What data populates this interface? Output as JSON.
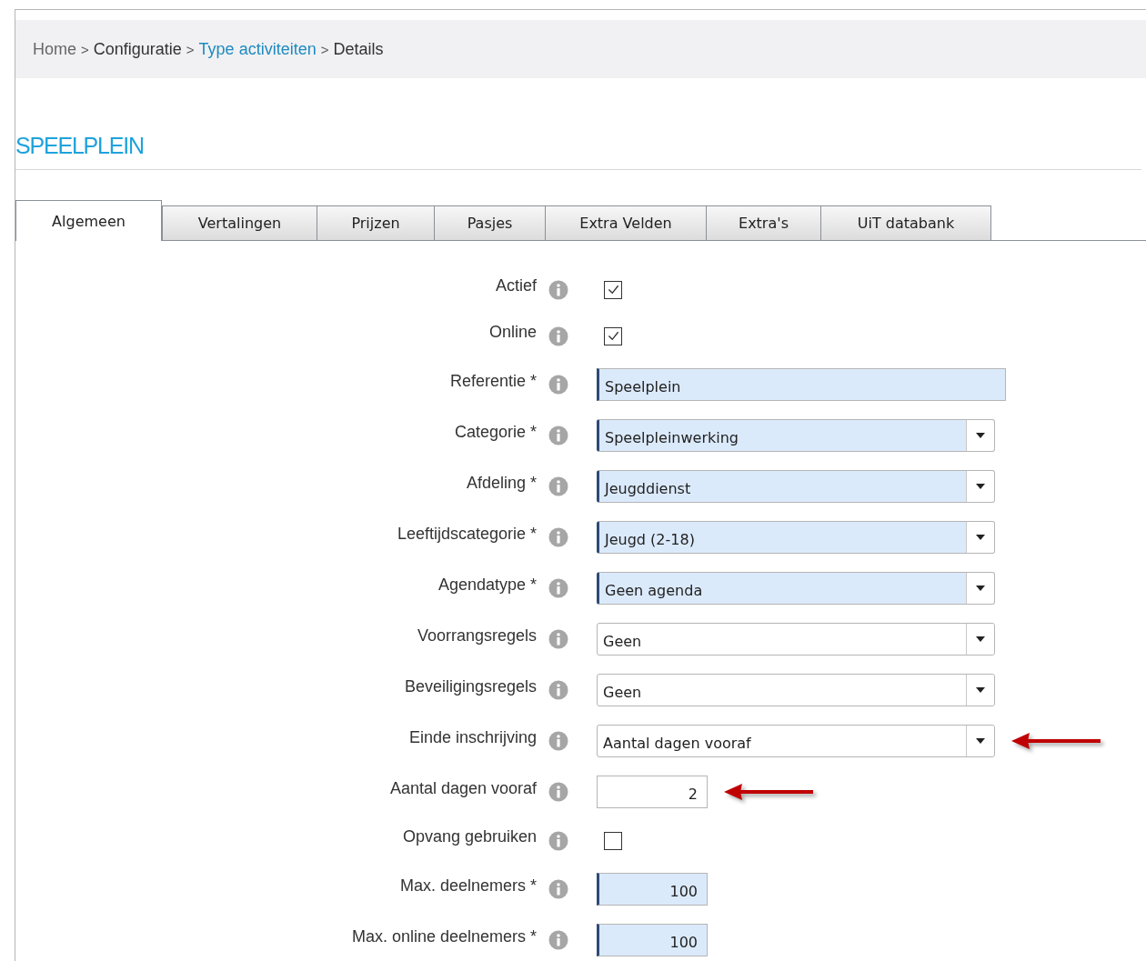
{
  "breadcrumb": [
    {
      "label": "Home",
      "kind": "muted"
    },
    {
      "label": ">",
      "kind": "separator"
    },
    {
      "label": "Configuratie",
      "kind": "plain"
    },
    {
      "label": ">",
      "kind": "separator"
    },
    {
      "label": "Type activiteiten",
      "kind": "link"
    },
    {
      "label": ">",
      "kind": "separator"
    },
    {
      "label": "Details",
      "kind": "plain"
    }
  ],
  "title": "SPEELPLEIN",
  "tabs": [
    {
      "label": "Algemeen",
      "selected": true
    },
    {
      "label": "Vertalingen",
      "selected": false
    },
    {
      "label": "Prijzen",
      "selected": false
    },
    {
      "label": "Pasjes",
      "selected": false
    },
    {
      "label": "Extra Velden",
      "selected": false
    },
    {
      "label": "Extra's",
      "selected": false
    },
    {
      "label": "UiT databank",
      "selected": false
    }
  ],
  "fields": [
    {
      "label": "Actief",
      "kind": "checkbox",
      "checked": true
    },
    {
      "label": "Online",
      "kind": "checkbox",
      "checked": true
    },
    {
      "label": "Referentie *",
      "kind": "text",
      "value": "Speelplein",
      "highlighted": true
    },
    {
      "label": "Categorie *",
      "kind": "select",
      "value": "Speelpleinwerking",
      "highlighted": true
    },
    {
      "label": "Afdeling *",
      "kind": "select",
      "value": "Jeugddienst",
      "highlighted": true
    },
    {
      "label": "Leeftijdscategorie *",
      "kind": "select",
      "value": "Jeugd (2-18)",
      "highlighted": true
    },
    {
      "label": "Agendatype *",
      "kind": "select",
      "value": "Geen agenda",
      "highlighted": true
    },
    {
      "label": "Voorrangsregels",
      "kind": "select",
      "value": "Geen",
      "highlighted": false
    },
    {
      "label": "Beveiligingsregels",
      "kind": "select",
      "value": "Geen",
      "highlighted": false
    },
    {
      "label": "Einde inschrijving",
      "kind": "select",
      "value": "Aantal dagen vooraf",
      "highlighted": false,
      "arrow": true
    },
    {
      "label": "Aantal dagen vooraf",
      "kind": "number",
      "value": "2",
      "highlighted": false,
      "arrow": true
    },
    {
      "label": "Opvang gebruiken",
      "kind": "checkbox",
      "checked": false
    },
    {
      "label": "Max. deelnemers *",
      "kind": "number",
      "value": "100",
      "highlighted": true
    },
    {
      "label": "Max. online deelnemers *",
      "kind": "number",
      "value": "100",
      "highlighted": true
    }
  ]
}
